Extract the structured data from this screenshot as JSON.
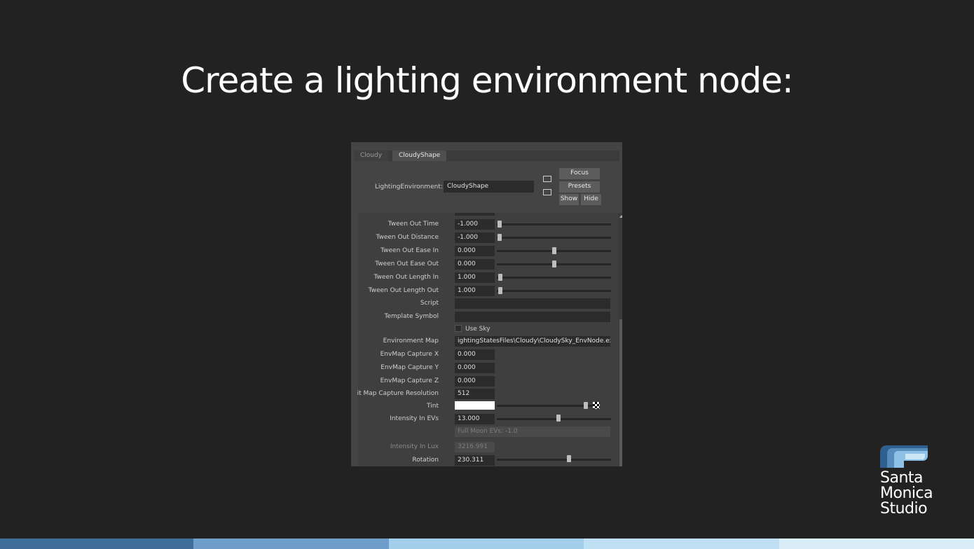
{
  "slide": {
    "title": "Create a lighting environment node:"
  },
  "tabs": [
    {
      "label": "Cloudy"
    },
    {
      "label": "CloudyShape"
    }
  ],
  "header": {
    "label": "LightingEnvironment:",
    "value": "CloudyShape",
    "buttons": {
      "focus": "Focus",
      "presets": "Presets",
      "show": "Show",
      "hide": "Hide"
    }
  },
  "attributes": {
    "tween_out_time": {
      "label": "Tween Out Time",
      "value": "-1.000",
      "slider": 0.0
    },
    "tween_out_distance": {
      "label": "Tween Out Distance",
      "value": "-1.000",
      "slider": 0.0
    },
    "tween_out_ease_in": {
      "label": "Tween Out Ease In",
      "value": "0.000",
      "slider": 0.5
    },
    "tween_out_ease_out": {
      "label": "Tween Out Ease Out",
      "value": "0.000",
      "slider": 0.5
    },
    "tween_out_length_in": {
      "label": "Tween Out Length In",
      "value": "1.000",
      "slider": 0.01
    },
    "tween_out_length_out": {
      "label": "Tween Out Length Out",
      "value": "1.000",
      "slider": 0.01
    },
    "script": {
      "label": "Script",
      "value": ""
    },
    "template_symbol": {
      "label": "Template Symbol",
      "value": ""
    },
    "use_sky": {
      "label": "Use Sky",
      "checked": false
    },
    "environment_map": {
      "label": "Environment Map",
      "value": "ightingStatesFiles\\Cloudy\\CloudySky_EnvNode.exr"
    },
    "envmap_capture_x": {
      "label": "EnvMap Capture X",
      "value": "0.000"
    },
    "envmap_capture_y": {
      "label": "EnvMap Capture Y",
      "value": "0.000"
    },
    "envmap_capture_z": {
      "label": "EnvMap Capture Z",
      "value": "0.000"
    },
    "capture_resolution": {
      "label": "it Map Capture Resolution",
      "value": "512"
    },
    "tint": {
      "label": "Tint",
      "color": "#ffffff",
      "slider": 0.99
    },
    "intensity_evs": {
      "label": "Intensity In EVs",
      "value": "13.000",
      "slider": 0.6
    },
    "full_moon_hint": {
      "value": "Full Moon EVs: -1.0"
    },
    "intensity_lux": {
      "label": "Intensity In Lux",
      "value": "3216.991"
    },
    "rotation": {
      "label": "Rotation",
      "value": "230.311",
      "slider": 0.64
    }
  },
  "logo": {
    "line1": "Santa",
    "line2": "Monica",
    "line3": "Studio",
    "colors": [
      "#2e5f8f",
      "#5a8fbf",
      "#8fc0e6",
      "#cde6f5"
    ]
  },
  "footer_colors": [
    "#3f6f99",
    "#6d9dc8",
    "#a3cfea",
    "#bfe0f2",
    "#d9edf7"
  ]
}
